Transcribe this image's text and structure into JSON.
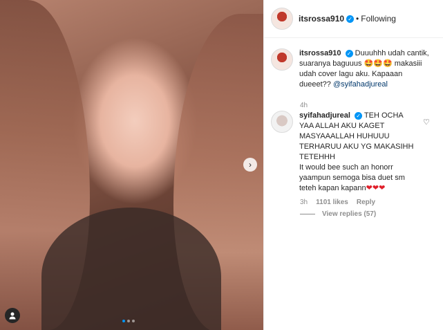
{
  "post": {
    "author": "itsrossa910",
    "separator": "•",
    "follow_status": "Following",
    "caption_text": "Duuuhhh udah cantik, suaranya baguuus 🤩🤩🤩 makasiii udah cover lagu aku. Kapaaan dueeet?? ",
    "caption_mention": "@syifahadjureal",
    "caption_time": "4h"
  },
  "reply": {
    "username": "syifahadjureal",
    "text": "TEH OCHA YAA ALLAH AKU KAGET MASYAAALLAH HUHUUU TERHARUU AKU YG MAKASIHH TETEHHH",
    "text2": "It would bee such an honorr yaampun semoga bisa duet sm teteh kapan kapann",
    "hearts": "❤❤❤",
    "time": "3h",
    "likes": "1101 likes",
    "reply_label": "Reply",
    "view_replies": "View replies (57)"
  },
  "icons": {
    "next": "chevron-right-icon",
    "user_tag": "user-icon",
    "like": "heart-icon",
    "verified": "verified-badge-icon"
  },
  "colors": {
    "link": "#00376b",
    "verified": "#0095f6",
    "muted": "#8e8e8e"
  }
}
